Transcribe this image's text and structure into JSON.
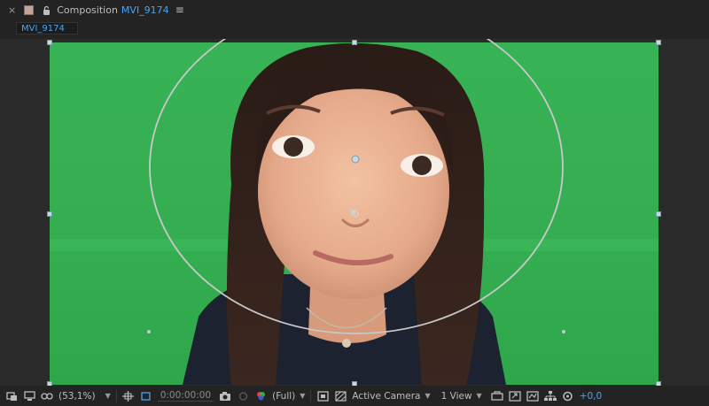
{
  "panel": {
    "close_glyph": "×",
    "label": "Composition",
    "comp_name": "MVI_9174",
    "menu_glyph": "≡",
    "swatch_color": "#c2a49a"
  },
  "tabs": [
    "MVI_9174"
  ],
  "viewer": {
    "background": "#2a2a2a",
    "footage_color": "#35ae52",
    "effect": "bulge"
  },
  "statusbar": {
    "zoom": "(53,1%)",
    "timecode": "0:00:00:00",
    "resolution": "(Full)",
    "camera": "Active Camera",
    "views": "1 View",
    "exposure": "+0,0"
  },
  "icons": [
    "toggle-mask-icon",
    "monitor-icon",
    "glasses-icon",
    "zoom-dropdown",
    "grid-icon",
    "region-of-interest-icon",
    "snapshot-icon",
    "show-snapshot-icon",
    "color-channel-icon",
    "fast-preview-icon",
    "transparency-grid-icon",
    "3d-renderer-icon",
    "flowchart-icon",
    "timeline-icon",
    "reset-exposure-icon"
  ]
}
